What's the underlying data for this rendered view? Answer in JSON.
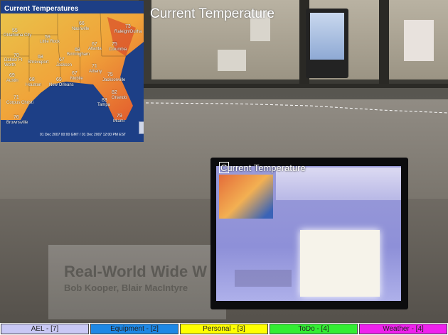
{
  "overlay": {
    "title": "Current Temperature",
    "monitor_caption": "Current Temperature"
  },
  "weather_map": {
    "title": "Current Temperatures",
    "footer": "01 Dec 2007 00:00 GMT / 01 Dec 2007 12:00 PM EST",
    "cities": [
      {
        "name": "Oklahoma City",
        "temp": "55"
      },
      {
        "name": "Nashville",
        "temp": "66"
      },
      {
        "name": "Raleigh/Durha",
        "temp": "73"
      },
      {
        "name": "Little Rock",
        "temp": "59"
      },
      {
        "name": "Birmingham",
        "temp": "68"
      },
      {
        "name": "Atlanta",
        "temp": "67"
      },
      {
        "name": "Columbia",
        "temp": "75"
      },
      {
        "name": "Dallas/ Ft Worth",
        "temp": "70"
      },
      {
        "name": "Shreveport",
        "temp": "68"
      },
      {
        "name": "Jackson",
        "temp": "67"
      },
      {
        "name": "Mobile",
        "temp": "67"
      },
      {
        "name": "Albany",
        "temp": "71"
      },
      {
        "name": "Austin",
        "temp": "69"
      },
      {
        "name": "Houston",
        "temp": "68"
      },
      {
        "name": "New Orleans",
        "temp": "69"
      },
      {
        "name": "Jacksonville",
        "temp": "75"
      },
      {
        "name": "Corpus Christi",
        "temp": "71"
      },
      {
        "name": "Orlando",
        "temp": "82"
      },
      {
        "name": "Tampa",
        "temp": "83"
      },
      {
        "name": "Brownsville",
        "temp": "76"
      },
      {
        "name": "Miami",
        "temp": "79"
      }
    ]
  },
  "poster": {
    "title": "Real-World Wide W",
    "subtitle": "Bob Kooper, Blair MacIntyre"
  },
  "tabs": [
    {
      "label": "AEL - [7]",
      "color": "#c9c8f5"
    },
    {
      "label": "Equipment - [2]",
      "color": "#1e88e5"
    },
    {
      "label": "Personal - [3]",
      "color": "#ffff00"
    },
    {
      "label": "ToDo - [4]",
      "color": "#33ee33"
    },
    {
      "label": "Weather - [4]",
      "color": "#ee22ee"
    }
  ]
}
